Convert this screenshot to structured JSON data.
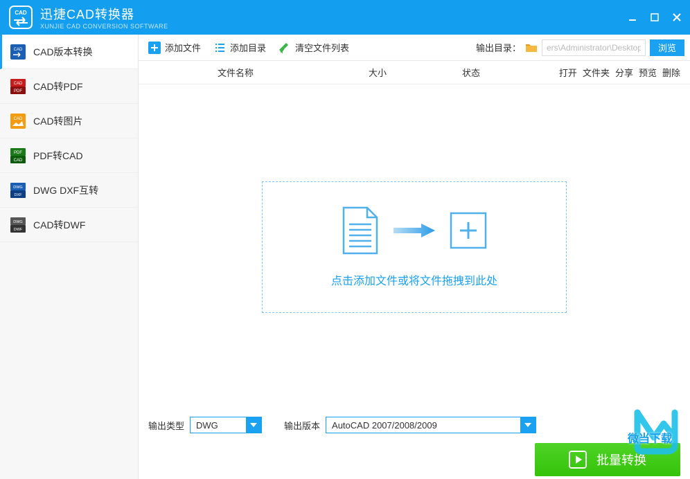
{
  "titlebar": {
    "title": "迅捷CAD转换器",
    "subtitle": "XUNJIE CAD CONVERSION SOFTWARE"
  },
  "sidebar": {
    "items": [
      {
        "label": "CAD版本转换"
      },
      {
        "label": "CAD转PDF"
      },
      {
        "label": "CAD转图片"
      },
      {
        "label": "PDF转CAD"
      },
      {
        "label": "DWG DXF互转"
      },
      {
        "label": "CAD转DWF"
      }
    ]
  },
  "toolbar": {
    "add_file": "添加文件",
    "add_dir": "添加目录",
    "clear_list": "清空文件列表",
    "outdir_label": "输出目录：",
    "path_value": "ers\\Administrator\\Desktop",
    "browse": "浏览"
  },
  "table": {
    "name": "文件名称",
    "size": "大小",
    "status": "状态",
    "actions": {
      "open": "打开",
      "folder": "文件夹",
      "share": "分享",
      "preview": "预览",
      "delete": "删除"
    }
  },
  "dropzone": {
    "text": "点击添加文件或将文件拖拽到此处"
  },
  "footer": {
    "out_type_label": "输出类型",
    "out_type_value": "DWG",
    "out_ver_label": "输出版本",
    "out_ver_value": "AutoCAD 2007/2008/2009",
    "convert": "批量转换"
  },
  "watermark": {
    "text": "微当下载"
  }
}
